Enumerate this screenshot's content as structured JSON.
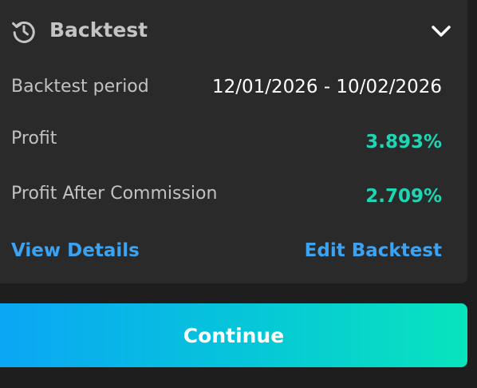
{
  "card": {
    "title": "Backtest",
    "header_icon": "history-icon",
    "toggle_icon": "chevron-down-icon",
    "rows": [
      {
        "label": "Backtest period",
        "value": "12/01/2026 - 10/02/2026"
      },
      {
        "label": "Profit",
        "value": "3.893%"
      },
      {
        "label": "Profit After Commission",
        "value": "2.709%"
      }
    ],
    "links": {
      "view_details": "View Details",
      "edit_backtest": "Edit Backtest"
    }
  },
  "continue_label": "Continue",
  "colors": {
    "page_background": "#1e1e1e",
    "card_background": "#2a2a2a",
    "profit_accent": "#1ed6b4",
    "link_accent": "#3ba3f2",
    "button_gradient_start": "#0ba6f5",
    "button_gradient_end": "#08e4bd"
  }
}
